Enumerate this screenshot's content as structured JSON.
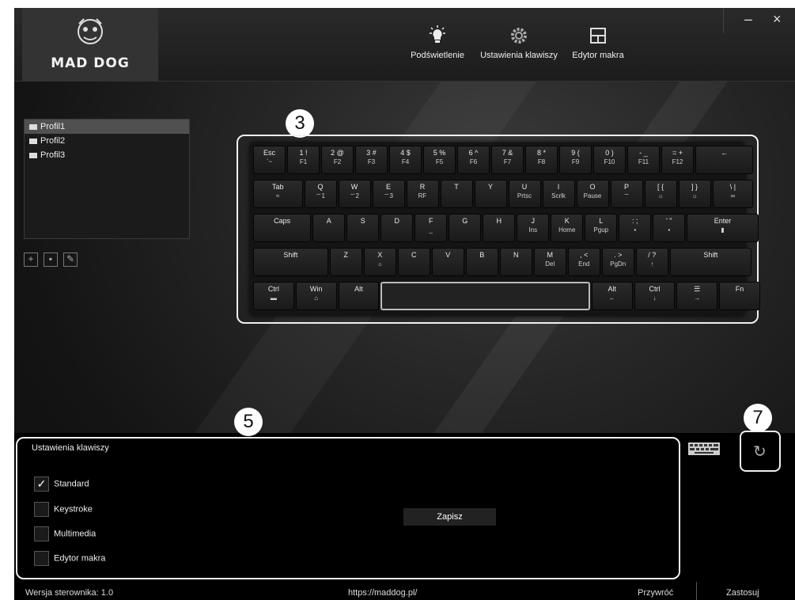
{
  "app": {
    "logo": "MAD DOG",
    "nav": [
      {
        "label": "Podświetlenie",
        "icon": "lightbulb-icon"
      },
      {
        "label": "Ustawienia klawiszy",
        "icon": "gear-icon"
      },
      {
        "label": "Edytor makra",
        "icon": "grid-icon"
      }
    ],
    "window": {
      "minimize": "–",
      "close": "×"
    }
  },
  "profiles": [
    "Profil1",
    "Profil2",
    "Profil3"
  ],
  "selected_profile": "Profil1",
  "keyboard": {
    "rows": [
      [
        [
          "Esc",
          "`~"
        ],
        [
          "1 !",
          "F1"
        ],
        [
          "2 @",
          "F2"
        ],
        [
          "3 #",
          "F3"
        ],
        [
          "4 $",
          "F4"
        ],
        [
          "5 %",
          "F5"
        ],
        [
          "6 ^",
          "F6"
        ],
        [
          "7 &",
          "F7"
        ],
        [
          "8 *",
          "F8"
        ],
        [
          "9 (",
          "F9"
        ],
        [
          "0 )",
          "F10"
        ],
        [
          "- _",
          "F11"
        ],
        [
          "= +",
          "F12"
        ],
        [
          "←",
          ""
        ]
      ],
      [
        [
          "Tab",
          "≈"
        ],
        [
          "Q",
          "⌔1"
        ],
        [
          "W",
          "⌔2"
        ],
        [
          "E",
          "⌔3"
        ],
        [
          "R",
          "RF"
        ],
        [
          "T",
          ""
        ],
        [
          "Y",
          ""
        ],
        [
          "U",
          "Prtsc"
        ],
        [
          "I",
          "Scrlk"
        ],
        [
          "O",
          "Pause"
        ],
        [
          "P",
          "⌔"
        ],
        [
          "[ {",
          "☼"
        ],
        [
          "] }",
          "☼"
        ],
        [
          "\\ |",
          "∞"
        ]
      ],
      [
        [
          "Caps",
          ""
        ],
        [
          "A",
          ""
        ],
        [
          "S",
          ""
        ],
        [
          "D",
          ""
        ],
        [
          "F",
          "_"
        ],
        [
          "G",
          ""
        ],
        [
          "H",
          ""
        ],
        [
          "J",
          "Ins"
        ],
        [
          "K",
          "Home"
        ],
        [
          "L",
          "Pgup"
        ],
        [
          ": ;",
          "▪"
        ],
        [
          "' \"",
          "▪"
        ],
        [
          "Enter",
          "▮"
        ]
      ],
      [
        [
          "Shift",
          ""
        ],
        [
          "Z",
          ""
        ],
        [
          "X",
          "☼"
        ],
        [
          "C",
          ""
        ],
        [
          "V",
          ""
        ],
        [
          "B",
          ""
        ],
        [
          "N",
          ""
        ],
        [
          "M",
          "Del"
        ],
        [
          ", <",
          "End"
        ],
        [
          ". >",
          "PgDn"
        ],
        [
          "/ ?",
          "↑"
        ],
        [
          "Shift",
          ""
        ]
      ],
      [
        [
          "Ctrl",
          "▬"
        ],
        [
          "Win",
          "⌂"
        ],
        [
          "Alt",
          ""
        ],
        [
          "",
          ""
        ],
        [
          "Alt",
          "←"
        ],
        [
          "Ctrl",
          "↓"
        ],
        [
          "☰",
          "→"
        ],
        [
          "Fn",
          ""
        ]
      ]
    ]
  },
  "markers": {
    "keyboard": "3",
    "settings": "5",
    "refresh": "7"
  },
  "settings_panel": {
    "title": "Ustawienia klawiszy",
    "options": [
      {
        "label": "Standard",
        "checked": true
      },
      {
        "label": "Keystroke",
        "checked": false
      },
      {
        "label": "Multimedia",
        "checked": false
      },
      {
        "label": "Edytor makra",
        "checked": false
      }
    ],
    "save_label": "Zapisz"
  },
  "footer": {
    "version": "Wersja sterownika: 1.0",
    "url": "https://maddog.pl/",
    "restore": "Przywróć",
    "apply": "Zastosuj"
  }
}
